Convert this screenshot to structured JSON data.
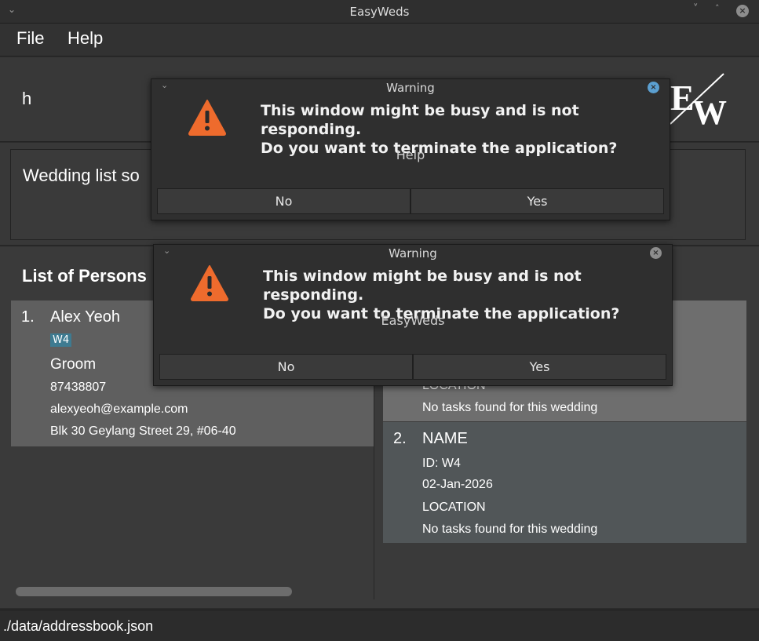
{
  "window": {
    "title": "EasyWeds",
    "chevron": "⌄",
    "minimize": "˅",
    "maximize": "˄",
    "close": "×"
  },
  "menu": {
    "file": "File",
    "help": "Help"
  },
  "command": {
    "text": "h"
  },
  "result": {
    "text": "Wedding list so"
  },
  "persons": {
    "title": "List of Persons",
    "items": [
      {
        "index": "1.",
        "name": "Alex Yeoh",
        "tag": "W4",
        "role": "Groom",
        "phone": "87438807",
        "email": "alexyeoh@example.com",
        "address": "Blk 30 Geylang Street 29, #06-40"
      }
    ]
  },
  "weddings": {
    "items": [
      {
        "location": "LOCATION",
        "tasks": "No tasks found for this wedding"
      },
      {
        "index": "2.",
        "name": "NAME",
        "id": "ID: W4",
        "date": "02-Jan-2026",
        "location": "LOCATION",
        "tasks": "No tasks found for this wedding"
      }
    ]
  },
  "status": {
    "path": "./data/addressbook.json"
  },
  "dialogs": [
    {
      "title": "Warning",
      "chevron": "⌄",
      "close": "×",
      "message_line1": "This window might be busy and is not responding.",
      "message_line2": "Do you want to terminate the application?",
      "subtitle": "Help",
      "no_label": "No",
      "yes_label": "Yes",
      "icon": "warning-icon"
    },
    {
      "title": "Warning",
      "chevron": "⌄",
      "close": "×",
      "message_line1": "This window might be busy and is not responding.",
      "message_line2": "Do you want to terminate the application?",
      "subtitle": "EasyWeds",
      "no_label": "No",
      "yes_label": "Yes",
      "icon": "warning-icon"
    }
  ],
  "colors": {
    "tag_bg": "#3e7b91",
    "warning_orange": "#ee6b2d",
    "card_selected": "#6e6e6e",
    "card_alt": "#515658"
  }
}
